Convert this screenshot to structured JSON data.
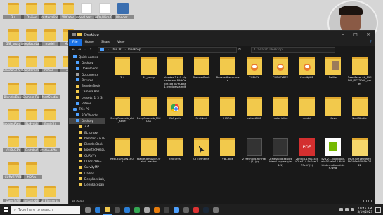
{
  "desktop": {
    "icons": [
      {
        "label": "3.4",
        "kind": "folder"
      },
      {
        "label": "Dailies",
        "kind": "folder"
      },
      {
        "label": "materialize",
        "kind": "folder"
      },
      {
        "label": "VBCable",
        "kind": "folder"
      },
      {
        "label": "model test.blend",
        "kind": "doc"
      },
      {
        "label": "280a/Wire G...",
        "kind": "doc"
      },
      {
        "label": "Blender...",
        "kind": "app"
      },
      {
        "label": "5f8_proxy",
        "kind": "folder"
      },
      {
        "label": "DeepFaceLab...",
        "kind": "folder"
      },
      {
        "label": "model",
        "kind": "folder"
      },
      {
        "label": "Multi",
        "kind": "folder"
      },
      {
        "label": "blender-3.6.0...",
        "kind": "folder"
      },
      {
        "label": "DeepFaceLab...",
        "kind": "folder"
      },
      {
        "label": "motion...",
        "kind": "folder"
      },
      {
        "label": "Alt",
        "kind": "folder"
      },
      {
        "label": "BlenderBook",
        "kind": "folder"
      },
      {
        "label": "Camera Roll",
        "kind": "folder"
      },
      {
        "label": "NerfStudio",
        "kind": "folder"
      },
      {
        "label": "BoostedResources",
        "kind": "folder"
      },
      {
        "label": "EbSynth",
        "kind": "folder"
      },
      {
        "label": "final (2)",
        "kind": "folder"
      },
      {
        "label": "CURVEFY",
        "kind": "folder"
      },
      {
        "label": "FirstNerf",
        "kind": "folder"
      },
      {
        "label": "stable-diffu...",
        "kind": "folder"
      },
      {
        "label": "CURVEFREE",
        "kind": "folder"
      },
      {
        "label": "HDRIs",
        "kind": "folder"
      },
      {
        "label": "CurvifyMP",
        "kind": "folder"
      },
      {
        "label": "InstantNGP",
        "kind": "folder"
      },
      {
        "label": "UI Elements",
        "kind": "folder"
      }
    ]
  },
  "window": {
    "title": "Desktop",
    "ribbon": {
      "file": "File",
      "tabs": [
        "Home",
        "Share",
        "View"
      ]
    },
    "address": {
      "root": "This PC",
      "current": "Desktop"
    },
    "search_placeholder": "Search Desktop",
    "nav": [
      {
        "label": "Quick access",
        "level": 0,
        "icon": "star-icon"
      },
      {
        "label": "Desktop",
        "level": 1,
        "icon": "desktop-icon"
      },
      {
        "label": "Downloads",
        "level": 1,
        "icon": "download-icon"
      },
      {
        "label": "Documents",
        "level": 1,
        "icon": "document-icon"
      },
      {
        "label": "Pictures",
        "level": 1,
        "icon": "picture-icon"
      },
      {
        "label": "BlenderBook",
        "level": 1,
        "icon": "folder-icon"
      },
      {
        "label": "Camera Roll",
        "level": 1,
        "icon": "folder-icon"
      },
      {
        "label": "presets_1_3_3",
        "level": 1,
        "icon": "folder-icon"
      },
      {
        "label": "Videos",
        "level": 1,
        "icon": "video-icon"
      },
      {
        "label": "This PC",
        "level": 0,
        "icon": "pc-icon"
      },
      {
        "label": "3D Objects",
        "level": 1,
        "icon": "cube-icon"
      },
      {
        "label": "Desktop",
        "level": 1,
        "icon": "desktop-icon",
        "selected": true
      },
      {
        "label": "3.4",
        "level": 2,
        "icon": "folder-icon"
      },
      {
        "label": "BL_proxy",
        "level": 2,
        "icon": "folder-icon"
      },
      {
        "label": "blender-3.6.0-a",
        "level": 2,
        "icon": "folder-icon"
      },
      {
        "label": "BlenderBook",
        "level": 2,
        "icon": "folder-icon"
      },
      {
        "label": "BoostedResour",
        "level": 2,
        "icon": "folder-icon"
      },
      {
        "label": "CURVFY",
        "level": 2,
        "icon": "folder-icon"
      },
      {
        "label": "CURVFYREE",
        "level": 2,
        "icon": "folder-icon"
      },
      {
        "label": "CurvifyMP",
        "level": 2,
        "icon": "folder-icon"
      },
      {
        "label": "Dailies",
        "level": 2,
        "icon": "folder-icon"
      },
      {
        "label": "DeepFaceLab_N",
        "level": 2,
        "icon": "folder-icon"
      },
      {
        "label": "DeepFaceLab_N",
        "level": 2,
        "icon": "folder-icon"
      }
    ],
    "items": [
      {
        "label": "3.4",
        "kind": "folder"
      },
      {
        "label": "BL_proxy",
        "kind": "folder"
      },
      {
        "label": "blender-3.6.0-alpha+main.89fb0ed5f3cd_b7e0b8e4-windows.amd6",
        "kind": "folder"
      },
      {
        "label": "BlenderBook",
        "kind": "folder"
      },
      {
        "label": "BoostedResources",
        "kind": "folder"
      },
      {
        "label": "CURVFY",
        "kind": "folder-owl"
      },
      {
        "label": "CURVFYREE",
        "kind": "folder-owl"
      },
      {
        "label": "CurvifyMP",
        "kind": "folder-owl"
      },
      {
        "label": "Dailies",
        "kind": "folder-pic"
      },
      {
        "label": "DeepFaceLab_NVIDIA_RTX3000_series",
        "kind": "folder"
      },
      {
        "label": "DeepFaceLab_old_saver",
        "kind": "folder"
      },
      {
        "label": "DeepFaceLab_NVIDIA",
        "kind": "folder"
      },
      {
        "label": "EbSynth",
        "kind": "folder-chrome"
      },
      {
        "label": "FirstNerf",
        "kind": "folder"
      },
      {
        "label": "HDRIs",
        "kind": "folder"
      },
      {
        "label": "InstantNGP",
        "kind": "folder"
      },
      {
        "label": "materialize",
        "kind": "folder"
      },
      {
        "label": "model",
        "kind": "folder"
      },
      {
        "label": "Music",
        "kind": "folder"
      },
      {
        "label": "NerfStudio",
        "kind": "folder"
      },
      {
        "label": "Real-ESRGAN-3.0.2",
        "kind": "folder"
      },
      {
        "label": "stable-diffusion-webui-master",
        "kind": "folder"
      },
      {
        "label": "textures",
        "kind": "folder"
      },
      {
        "label": "UI Elements",
        "kind": "folder-cursor"
      },
      {
        "label": "VBCable",
        "kind": "folder"
      },
      {
        "label": "2 Methods for Hair (1).jpg",
        "kind": "image"
      },
      {
        "label": "2 Meshing.skulpt blend-superstyle 4(1)",
        "kind": "image"
      },
      {
        "label": "2bf4bb-1961-4 5b2-a414-9c0ae 773c1f (1)",
        "kind": "pdf"
      },
      {
        "label": "526.21-notebook-win10-win11-64bit-international-dch-whql",
        "kind": "nvidia"
      },
      {
        "label": "c90930e1e9d6e08b226a2f5b5b 2442",
        "kind": "zip"
      }
    ],
    "status": "30 items"
  },
  "taskbar": {
    "search_placeholder": "Type here to search",
    "apps": [
      "task-view-icon",
      "edge-icon",
      "explorer-icon",
      "store-icon",
      "mail-icon",
      "chrome-icon",
      "settings-icon",
      "blender-icon",
      "obs-icon",
      "photos-icon",
      "terminal-icon",
      "media-icon",
      "steam-icon",
      "cam-icon"
    ],
    "time": "10:45 AM",
    "date": "5/19/2023"
  }
}
